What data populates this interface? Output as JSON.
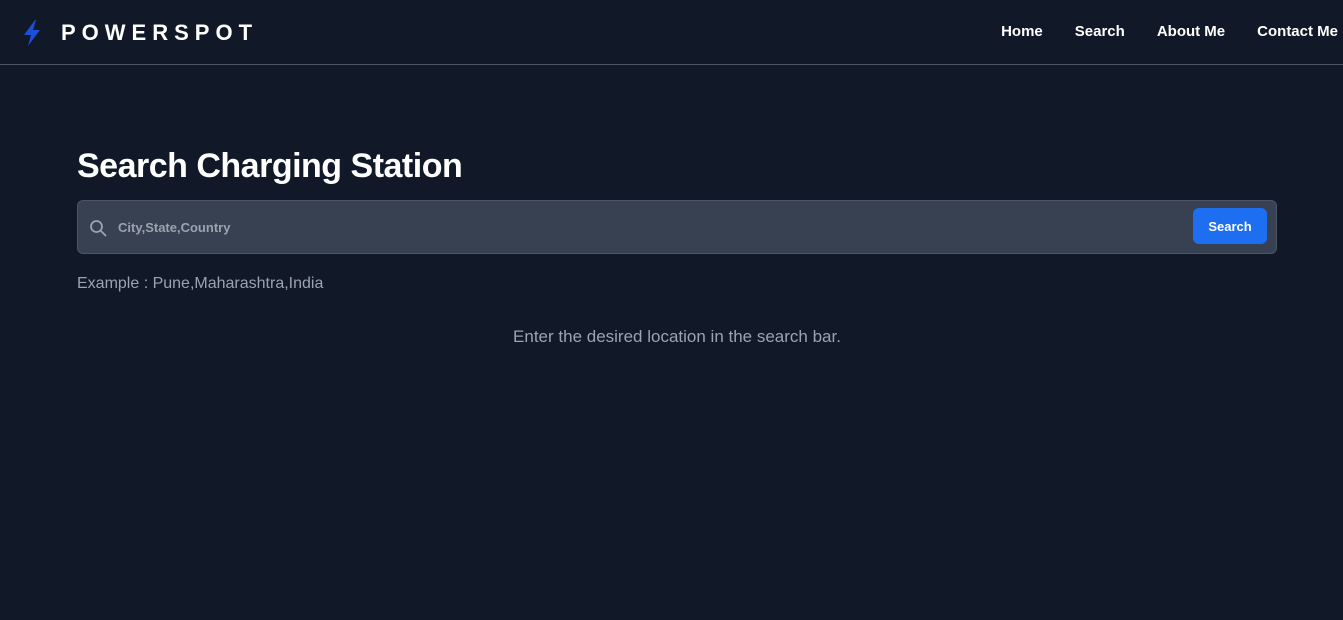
{
  "brand": {
    "name": "POWERSPOT",
    "icon": "lightning-bolt-icon",
    "icon_color": "#1d4ed8"
  },
  "nav": {
    "items": [
      {
        "label": "Home"
      },
      {
        "label": "Search"
      },
      {
        "label": "About Me"
      },
      {
        "label": "Contact Me"
      }
    ]
  },
  "main": {
    "title": "Search Charging Station",
    "search": {
      "placeholder": "City,State,Country",
      "value": "",
      "button_label": "Search",
      "icon": "search-icon"
    },
    "example": "Example : Pune,Maharashtra,India",
    "hint": "Enter the desired location in the search bar."
  },
  "colors": {
    "background": "#111827",
    "search_bar": "#374151",
    "accent": "#1d6ef0",
    "muted_text": "#9ca3af"
  }
}
